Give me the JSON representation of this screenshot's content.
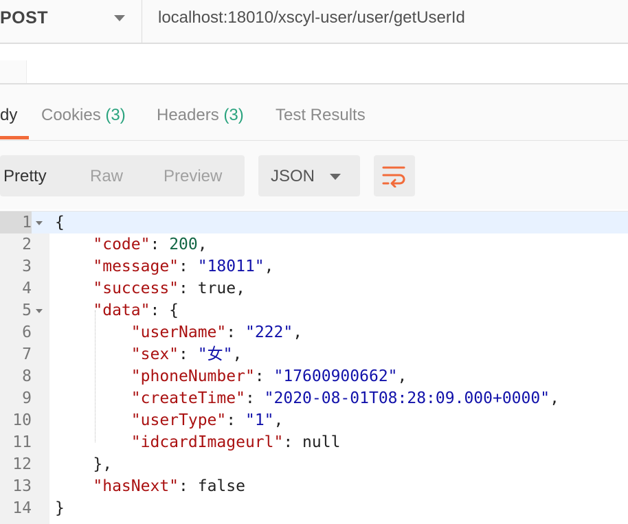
{
  "request": {
    "method": "POST",
    "url": "localhost:18010/xscyl-user/user/getUserId"
  },
  "response_tabs": [
    {
      "label": "dy",
      "count": ""
    },
    {
      "label": "Cookies",
      "count": "(3)"
    },
    {
      "label": "Headers",
      "count": "(3)"
    },
    {
      "label": "Test Results",
      "count": ""
    }
  ],
  "format_buttons": [
    "Pretty",
    "Raw",
    "Preview"
  ],
  "language": "JSON",
  "colors": {
    "accent": "#f26b3a",
    "count": "#2aa37e",
    "key": "#aa1111",
    "string": "#1111aa"
  },
  "icons": {
    "wrap": "wrap-lines-icon",
    "fold": "fold-caret-icon",
    "dropdown": "chevron-down-icon"
  },
  "code_lines": [
    {
      "num": "1",
      "foldable": true,
      "active": true,
      "text": "{"
    },
    {
      "num": "2",
      "text": "    \"code\": 200,"
    },
    {
      "num": "3",
      "text": "    \"message\": \"18011\","
    },
    {
      "num": "4",
      "text": "    \"success\": true,"
    },
    {
      "num": "5",
      "foldable": true,
      "text": "    \"data\": {"
    },
    {
      "num": "6",
      "text": "        \"userName\": \"222\","
    },
    {
      "num": "7",
      "text": "        \"sex\": \"女\","
    },
    {
      "num": "8",
      "text": "        \"phoneNumber\": \"17600900662\","
    },
    {
      "num": "9",
      "text": "        \"createTime\": \"2020-08-01T08:28:09.000+0000\","
    },
    {
      "num": "10",
      "text": "        \"userType\": \"1\","
    },
    {
      "num": "11",
      "text": "        \"idcardImageurl\": null"
    },
    {
      "num": "12",
      "text": "    },"
    },
    {
      "num": "13",
      "text": "    \"hasNext\": false"
    },
    {
      "num": "14",
      "text": "}"
    }
  ]
}
